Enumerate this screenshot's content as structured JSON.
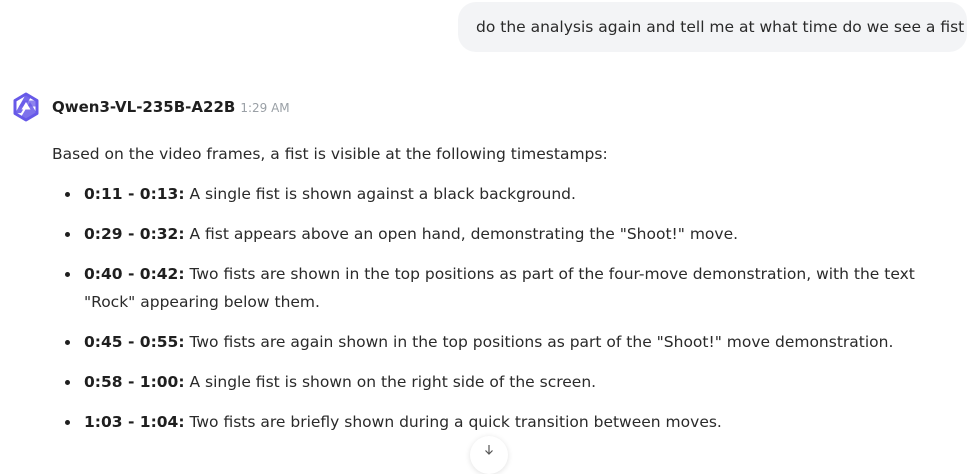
{
  "user_message": "do the analysis again and tell me  at what time do we see a fist",
  "assistant": {
    "model_name": "Qwen3-VL-235B-A22B",
    "time": "1:29 AM",
    "intro": "Based on the video frames, a fist is visible at the following timestamps:",
    "items": [
      {
        "time": "0:11 - 0:13:",
        "text": " A single fist is shown against a black background."
      },
      {
        "time": "0:29 - 0:32:",
        "text": " A fist appears above an open hand, demonstrating the \"Shoot!\" move."
      },
      {
        "time": "0:40 - 0:42:",
        "text": " Two fists are shown in the top positions as part of the four-move demonstration, with the text \"Rock\" appearing below them."
      },
      {
        "time": "0:45 - 0:55:",
        "text": " Two fists are again shown in the top positions as part of the \"Shoot!\" move demonstration."
      },
      {
        "time": "0:58 - 1:00:",
        "text": " A single fist is shown on the right side of the screen."
      },
      {
        "time": "1:03 - 1:04:",
        "text": " Two fists are briefly shown during a quick transition between moves."
      }
    ]
  },
  "icons": {
    "logo": "qwen-logo-icon",
    "scroll": "arrow-down-icon"
  },
  "colors": {
    "user_bubble_bg": "#f3f4f6",
    "logo": "#6759e8",
    "timestamp": "#9aa0a6"
  }
}
